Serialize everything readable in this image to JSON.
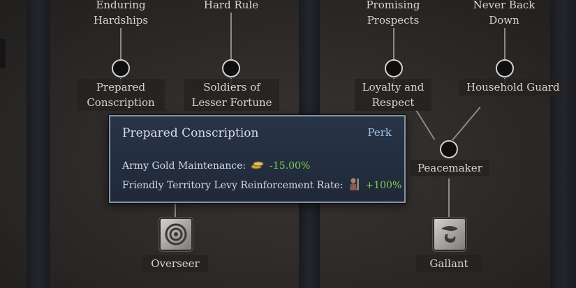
{
  "tree": {
    "left": {
      "top_labels": [
        "Enduring\nHardships",
        "Hard Rule"
      ],
      "mid_labels": [
        "Prepared\nConscription",
        "Soldiers of\nLesser Fortune"
      ],
      "bottom_perk": "Overseer"
    },
    "right": {
      "top_labels": [
        "Promising\nProspects",
        "Never Back\nDown"
      ],
      "mid_labels": [
        "Loyalty and\nRespect",
        "Household Guard"
      ],
      "merge_label": "Peacemaker",
      "bottom_perk": "Gallant"
    }
  },
  "tooltip": {
    "title": "Prepared Conscription",
    "type": "Perk",
    "lines": [
      {
        "label": "Army Gold Maintenance:",
        "icon": "gold-coins-icon",
        "value": "-15.00%"
      },
      {
        "label": "Friendly Territory Levy Reinforcement Rate:",
        "icon": "levy-soldier-icon",
        "value": "+100%"
      }
    ]
  },
  "colors": {
    "positive": "#7fcf4f",
    "perk_type": "#9fc3e6"
  }
}
